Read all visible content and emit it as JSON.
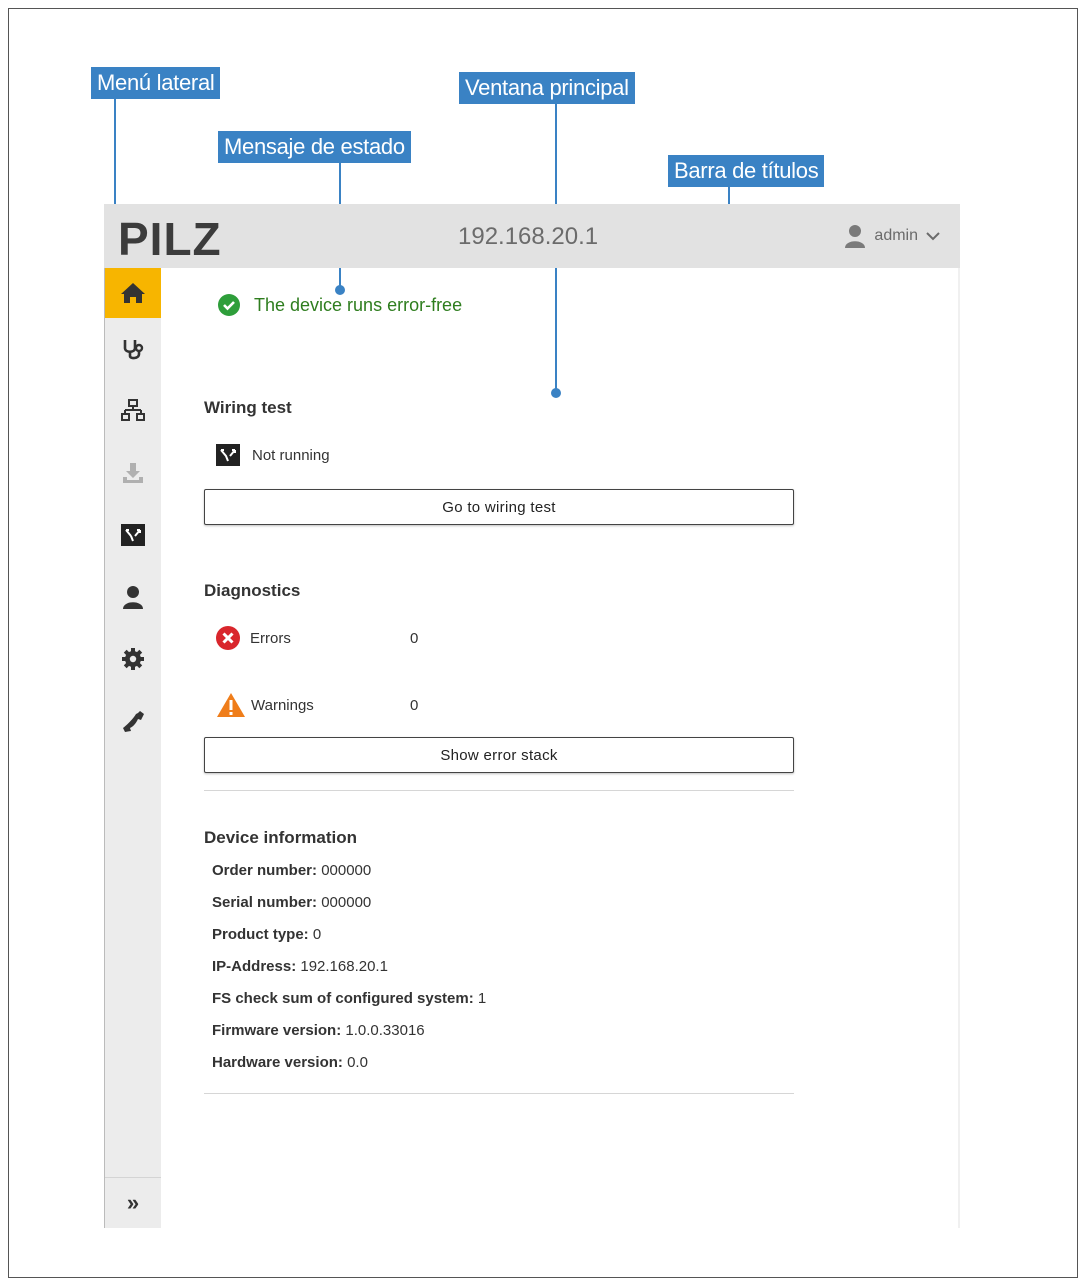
{
  "callouts": {
    "menu_lateral": "Menú lateral",
    "ventana_principal": "Ventana principal",
    "mensaje_estado": "Mensaje de estado",
    "barra_titulos": "Barra de títulos"
  },
  "titlebar": {
    "logo": "PILZ",
    "ip": "192.168.20.1",
    "user": "admin"
  },
  "sidebar": {
    "items": [
      {
        "icon": "home-icon",
        "active": true
      },
      {
        "icon": "stethoscope-icon"
      },
      {
        "icon": "network-icon"
      },
      {
        "icon": "download-icon",
        "disabled": true
      },
      {
        "icon": "wiring-test-icon"
      },
      {
        "icon": "user-icon"
      },
      {
        "icon": "gear-icon"
      },
      {
        "icon": "phone-icon"
      }
    ],
    "collapse": "»"
  },
  "status": {
    "message": "The device runs error-free",
    "color": "#2e7d1e"
  },
  "wiring": {
    "title": "Wiring test",
    "state": "Not running",
    "button": "Go to wiring test"
  },
  "diagnostics": {
    "title": "Diagnostics",
    "errors_label": "Errors",
    "errors_value": "0",
    "warnings_label": "Warnings",
    "warnings_value": "0",
    "button": "Show error stack"
  },
  "device_info": {
    "title": "Device information",
    "rows": [
      {
        "label": "Order number:",
        "value": "000000"
      },
      {
        "label": "Serial number:",
        "value": "000000"
      },
      {
        "label": "Product type:",
        "value": "0"
      },
      {
        "label": "IP-Address:",
        "value": "192.168.20.1"
      },
      {
        "label": "FS check sum of configured system:",
        "value": "1"
      },
      {
        "label": "Firmware version:",
        "value": "1.0.0.33016"
      },
      {
        "label": "Hardware version:",
        "value": "0.0"
      }
    ]
  },
  "colors": {
    "accent": "#f7b500",
    "callout": "#3a82c4",
    "error": "#d9262c",
    "warning": "#ef7d1a"
  }
}
